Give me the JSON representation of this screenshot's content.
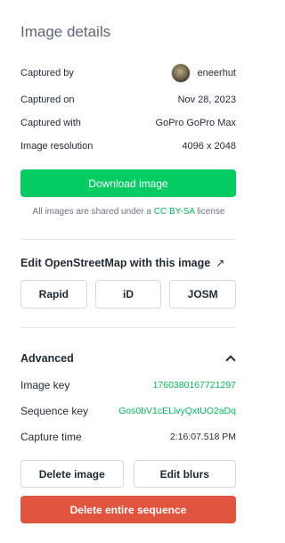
{
  "panel": {
    "title": "Image details"
  },
  "details": {
    "captured_by_label": "Captured by",
    "captured_by_value": "eneerhut",
    "captured_on_label": "Captured on",
    "captured_on_value": "Nov 28, 2023",
    "captured_with_label": "Captured with",
    "captured_with_value": "GoPro GoPro Max",
    "resolution_label": "Image resolution",
    "resolution_value": "4096 x 2048"
  },
  "download": {
    "label": "Download image"
  },
  "license": {
    "prefix": "All images are shared under a",
    "link": "CC BY-SA",
    "suffix": "license"
  },
  "osm": {
    "title": "Edit OpenStreetMap with this image",
    "arrow": "↗",
    "editors": [
      "Rapid",
      "iD",
      "JOSM"
    ]
  },
  "advanced": {
    "title": "Advanced",
    "image_key_label": "Image key",
    "image_key_value": "1760380167721297",
    "sequence_key_label": "Sequence key",
    "sequence_key_value": "Gos0bV1cELlvyQxtUO2aDq",
    "capture_time_label": "Capture time",
    "capture_time_value": "2:16:07.518 PM"
  },
  "actions": {
    "delete_image": "Delete image",
    "edit_blurs": "Edit blurs",
    "delete_sequence": "Delete entire sequence"
  },
  "colors": {
    "accent": "#05cb63",
    "link": "#05b85a",
    "danger": "#e05440"
  }
}
